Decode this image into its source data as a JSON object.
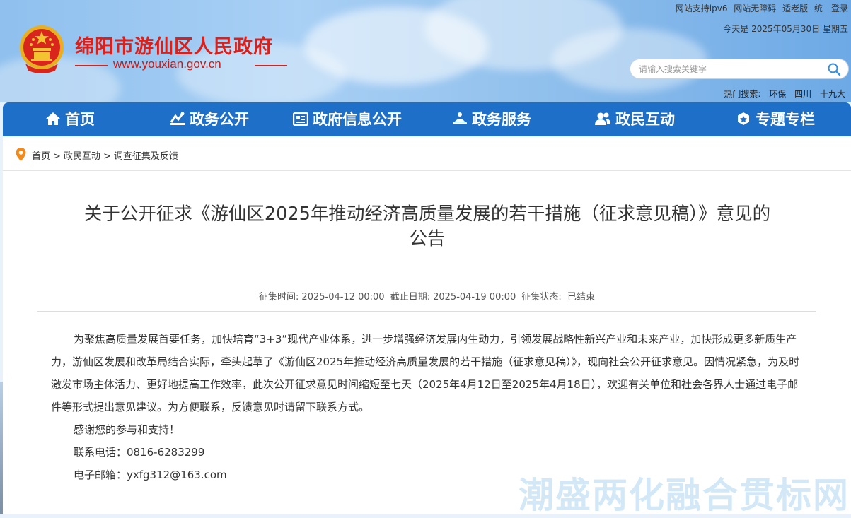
{
  "header": {
    "site_title": "绵阳市游仙区人民政府",
    "site_url": "www.youxian.gov.cn",
    "top_links": [
      "网站支持ipv6",
      "网站无障碍",
      "适老版",
      "统一登录"
    ],
    "today": "今天是 2025年05月30日 星期五",
    "search_placeholder": "请输入搜索关键字",
    "hot_label": "热门搜索:",
    "hot_words": [
      "环保",
      "四川",
      "十九大"
    ]
  },
  "nav": {
    "items": [
      {
        "label": "首页",
        "icon": "home-icon"
      },
      {
        "label": "政务公开",
        "icon": "chart-icon"
      },
      {
        "label": "政府信息公开",
        "icon": "document-icon"
      },
      {
        "label": "政务服务",
        "icon": "service-icon"
      },
      {
        "label": "政民互动",
        "icon": "users-icon"
      },
      {
        "label": "专题专栏",
        "icon": "badge-icon"
      }
    ]
  },
  "breadcrumb": [
    "首页",
    "政民互动",
    "调查征集及反馈"
  ],
  "breadcrumb_sep": ">",
  "article": {
    "title_line1": "关于公开征求《游仙区2025年推动经济高质量发展的若干措施（征求意见稿）》意见的",
    "title_line2": "公告",
    "meta": {
      "start_label": "征集时间:",
      "start": "2025-04-12 00:00",
      "end_label": "截止日期:",
      "end": "2025-04-19 00:00",
      "status_label": "征集状态:",
      "status": "已结束"
    },
    "paragraph": "为聚焦高质量发展首要任务，加快培育“3+3”现代产业体系，进一步增强经济发展内生动力，引领发展战略性新兴产业和未来产业，加快形成更多新质生产力，游仙区发展和改革局结合实际，牵头起草了《游仙区2025年推动经济高质量发展的若干措施（征求意见稿）》，现向社会公开征求意见。因情况紧急，为及时激发市场主体活力、更好地提高工作效率，此次公开征求意见时间缩短至七天（2025年4月12日至2025年4月18日），欢迎有关单位和社会各界人士通过电子邮件等形式提出意见建议。为方便联系，反馈意见时请留下联系方式。",
    "thanks": "感谢您的参与和支持！",
    "phone": "联系电话：0816-6283299",
    "email": "电子邮箱：yxfg312@163.com"
  },
  "watermark": "潮盛两化融合贯标网",
  "colors": {
    "nav_bg": "#1e6fc7",
    "title_red": "#d9201a"
  }
}
